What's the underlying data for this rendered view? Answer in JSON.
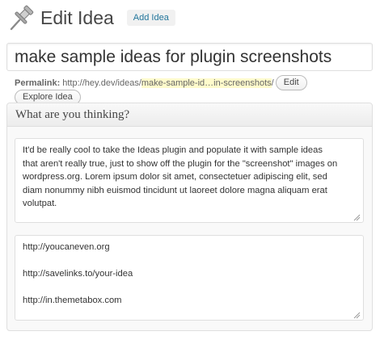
{
  "header": {
    "title": "Edit Idea",
    "add_button": "Add Idea",
    "icon": "pushpin-icon"
  },
  "title_field": {
    "value": "make sample ideas for plugin screenshots"
  },
  "permalink": {
    "label": "Permalink:",
    "base_url": "http://hey.dev/ideas/",
    "slug": "make-sample-id…in-screenshots",
    "trailing": "/",
    "edit_button": "Edit",
    "explore_button": "Explore Idea"
  },
  "postbox": {
    "title": "What are you thinking?",
    "description_lines": [
      "It'd be really cool to take the Ideas plugin and populate it with sample ideas",
      "that aren't really true, just to show off the plugin for the \"screenshot\" images on",
      "wordpress.org. Lorem ipsum dolor sit amet, consectetuer adipiscing elit, sed",
      "diam nonummy nibh euismod tincidunt ut laoreet dolore magna aliquam erat",
      "volutpat."
    ],
    "links_lines": [
      "http://youcaneven.org",
      "http://savelinks.to/your-idea",
      "http://in.themetabox.com"
    ]
  },
  "colors": {
    "link_blue": "#21759b",
    "slug_highlight": "#fffbcc",
    "border": "#dfdfdf"
  }
}
